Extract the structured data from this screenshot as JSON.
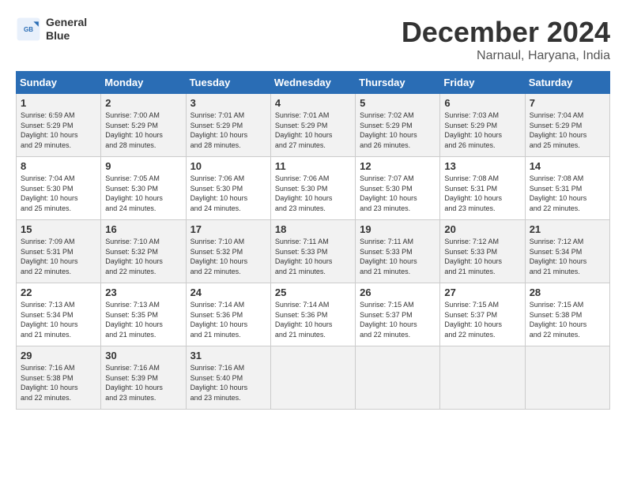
{
  "header": {
    "logo_line1": "General",
    "logo_line2": "Blue",
    "month": "December 2024",
    "location": "Narnaul, Haryana, India"
  },
  "days_of_week": [
    "Sunday",
    "Monday",
    "Tuesday",
    "Wednesday",
    "Thursday",
    "Friday",
    "Saturday"
  ],
  "weeks": [
    [
      {
        "day": "1",
        "info": "Sunrise: 6:59 AM\nSunset: 5:29 PM\nDaylight: 10 hours\nand 29 minutes."
      },
      {
        "day": "2",
        "info": "Sunrise: 7:00 AM\nSunset: 5:29 PM\nDaylight: 10 hours\nand 28 minutes."
      },
      {
        "day": "3",
        "info": "Sunrise: 7:01 AM\nSunset: 5:29 PM\nDaylight: 10 hours\nand 28 minutes."
      },
      {
        "day": "4",
        "info": "Sunrise: 7:01 AM\nSunset: 5:29 PM\nDaylight: 10 hours\nand 27 minutes."
      },
      {
        "day": "5",
        "info": "Sunrise: 7:02 AM\nSunset: 5:29 PM\nDaylight: 10 hours\nand 26 minutes."
      },
      {
        "day": "6",
        "info": "Sunrise: 7:03 AM\nSunset: 5:29 PM\nDaylight: 10 hours\nand 26 minutes."
      },
      {
        "day": "7",
        "info": "Sunrise: 7:04 AM\nSunset: 5:29 PM\nDaylight: 10 hours\nand 25 minutes."
      }
    ],
    [
      {
        "day": "8",
        "info": "Sunrise: 7:04 AM\nSunset: 5:30 PM\nDaylight: 10 hours\nand 25 minutes."
      },
      {
        "day": "9",
        "info": "Sunrise: 7:05 AM\nSunset: 5:30 PM\nDaylight: 10 hours\nand 24 minutes."
      },
      {
        "day": "10",
        "info": "Sunrise: 7:06 AM\nSunset: 5:30 PM\nDaylight: 10 hours\nand 24 minutes."
      },
      {
        "day": "11",
        "info": "Sunrise: 7:06 AM\nSunset: 5:30 PM\nDaylight: 10 hours\nand 23 minutes."
      },
      {
        "day": "12",
        "info": "Sunrise: 7:07 AM\nSunset: 5:30 PM\nDaylight: 10 hours\nand 23 minutes."
      },
      {
        "day": "13",
        "info": "Sunrise: 7:08 AM\nSunset: 5:31 PM\nDaylight: 10 hours\nand 23 minutes."
      },
      {
        "day": "14",
        "info": "Sunrise: 7:08 AM\nSunset: 5:31 PM\nDaylight: 10 hours\nand 22 minutes."
      }
    ],
    [
      {
        "day": "15",
        "info": "Sunrise: 7:09 AM\nSunset: 5:31 PM\nDaylight: 10 hours\nand 22 minutes."
      },
      {
        "day": "16",
        "info": "Sunrise: 7:10 AM\nSunset: 5:32 PM\nDaylight: 10 hours\nand 22 minutes."
      },
      {
        "day": "17",
        "info": "Sunrise: 7:10 AM\nSunset: 5:32 PM\nDaylight: 10 hours\nand 22 minutes."
      },
      {
        "day": "18",
        "info": "Sunrise: 7:11 AM\nSunset: 5:33 PM\nDaylight: 10 hours\nand 21 minutes."
      },
      {
        "day": "19",
        "info": "Sunrise: 7:11 AM\nSunset: 5:33 PM\nDaylight: 10 hours\nand 21 minutes."
      },
      {
        "day": "20",
        "info": "Sunrise: 7:12 AM\nSunset: 5:33 PM\nDaylight: 10 hours\nand 21 minutes."
      },
      {
        "day": "21",
        "info": "Sunrise: 7:12 AM\nSunset: 5:34 PM\nDaylight: 10 hours\nand 21 minutes."
      }
    ],
    [
      {
        "day": "22",
        "info": "Sunrise: 7:13 AM\nSunset: 5:34 PM\nDaylight: 10 hours\nand 21 minutes."
      },
      {
        "day": "23",
        "info": "Sunrise: 7:13 AM\nSunset: 5:35 PM\nDaylight: 10 hours\nand 21 minutes."
      },
      {
        "day": "24",
        "info": "Sunrise: 7:14 AM\nSunset: 5:36 PM\nDaylight: 10 hours\nand 21 minutes."
      },
      {
        "day": "25",
        "info": "Sunrise: 7:14 AM\nSunset: 5:36 PM\nDaylight: 10 hours\nand 21 minutes."
      },
      {
        "day": "26",
        "info": "Sunrise: 7:15 AM\nSunset: 5:37 PM\nDaylight: 10 hours\nand 22 minutes."
      },
      {
        "day": "27",
        "info": "Sunrise: 7:15 AM\nSunset: 5:37 PM\nDaylight: 10 hours\nand 22 minutes."
      },
      {
        "day": "28",
        "info": "Sunrise: 7:15 AM\nSunset: 5:38 PM\nDaylight: 10 hours\nand 22 minutes."
      }
    ],
    [
      {
        "day": "29",
        "info": "Sunrise: 7:16 AM\nSunset: 5:38 PM\nDaylight: 10 hours\nand 22 minutes."
      },
      {
        "day": "30",
        "info": "Sunrise: 7:16 AM\nSunset: 5:39 PM\nDaylight: 10 hours\nand 23 minutes."
      },
      {
        "day": "31",
        "info": "Sunrise: 7:16 AM\nSunset: 5:40 PM\nDaylight: 10 hours\nand 23 minutes."
      },
      {
        "day": "",
        "info": ""
      },
      {
        "day": "",
        "info": ""
      },
      {
        "day": "",
        "info": ""
      },
      {
        "day": "",
        "info": ""
      }
    ]
  ]
}
